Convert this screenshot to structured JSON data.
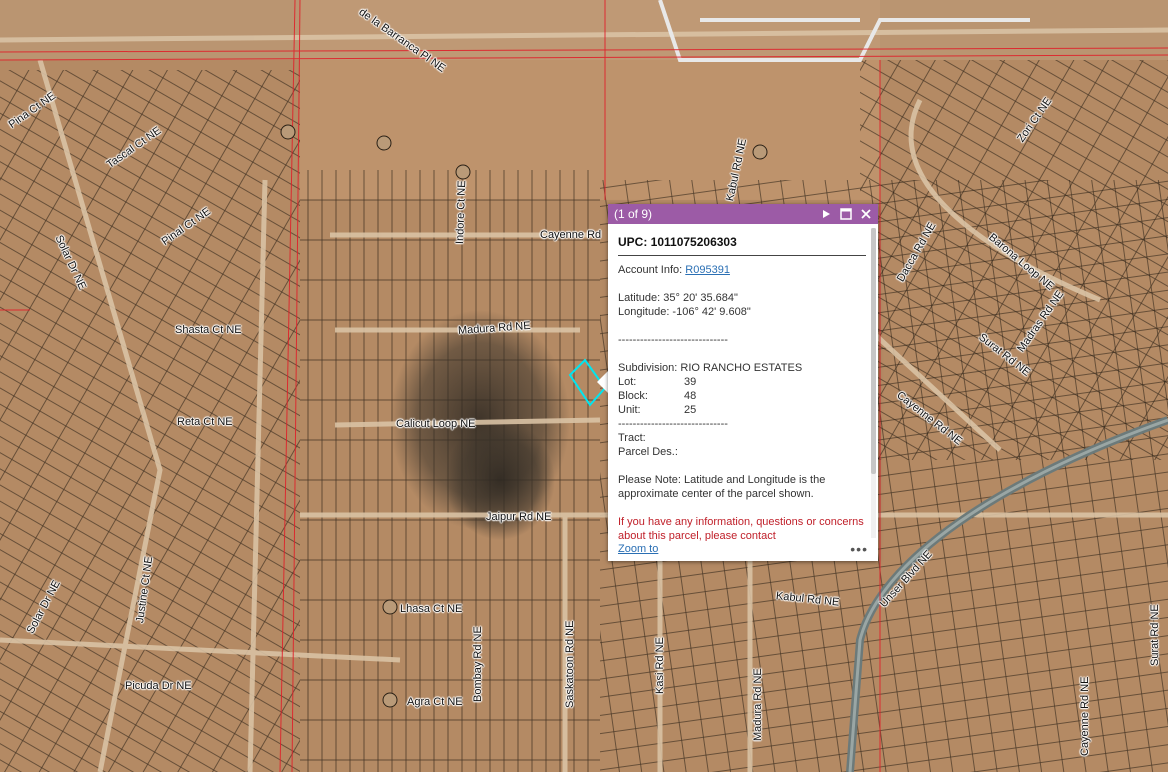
{
  "map": {
    "road_labels": [
      {
        "text": "de la Barranca Pl NE"
      },
      {
        "text": "Pina Ct NE"
      },
      {
        "text": "Tascal Ct NE"
      },
      {
        "text": "Pinal Ct NE"
      },
      {
        "text": "Solar Dr NE"
      },
      {
        "text": "Indore Ct NE"
      },
      {
        "text": "Cayenne Rd"
      },
      {
        "text": "Shasta Ct NE"
      },
      {
        "text": "Madura Rd NE"
      },
      {
        "text": "Reta Ct NE"
      },
      {
        "text": "Calicut Loop NE"
      },
      {
        "text": "Jaipur Rd NE"
      },
      {
        "text": "Justine Ct NE"
      },
      {
        "text": "Solar Dr NE"
      },
      {
        "text": "Lhasa Ct NE"
      },
      {
        "text": "Bombay Rd NE"
      },
      {
        "text": "Saskatoon Rd NE"
      },
      {
        "text": "Kabul Rd NE"
      },
      {
        "text": "Madura Rd NE"
      },
      {
        "text": "Picuda Dr NE"
      },
      {
        "text": "Agra Ct NE"
      },
      {
        "text": "Zori Ct NE"
      },
      {
        "text": "Barona Loop NE"
      },
      {
        "text": "Dacca Rd NE"
      },
      {
        "text": "Madras Rd NE"
      },
      {
        "text": "Surat Rd NE"
      },
      {
        "text": "Cayenne Rd NE"
      },
      {
        "text": "Unser Blvd NE"
      },
      {
        "text": "Cayenne Rd NE"
      },
      {
        "text": "Surat Rd NE"
      },
      {
        "text": "Kabul Rd NE"
      },
      {
        "text": "Kasi Rd NE"
      }
    ]
  },
  "popup": {
    "count": "(1 of 9)",
    "title": "UPC: 1011075206303",
    "account_label": "Account Info:",
    "account_link": "R095391",
    "latitude": "Latitude: 35° 20' 35.684\"",
    "longitude": "Longitude: -106° 42' 9.608\"",
    "divider": "------------------------------",
    "subdivision": "Subdivision: RIO RANCHO ESTATES",
    "lot_label": "Lot:",
    "lot_value": "39",
    "block_label": "Block:",
    "block_value": "48",
    "unit_label": "Unit:",
    "unit_value": "25",
    "tract": "Tract:",
    "parcel_des": "Parcel Des.:",
    "note": "Please Note: Latitude and Longitude is the approximate center of the parcel shown.",
    "contact": "If you have any information, questions or concerns about this parcel, please contact",
    "zoom_to": "Zoom to",
    "more": "•••"
  },
  "colors": {
    "header": "#9c5ba6",
    "highlight": "#00e5f0",
    "boundary": "#e0202a"
  }
}
